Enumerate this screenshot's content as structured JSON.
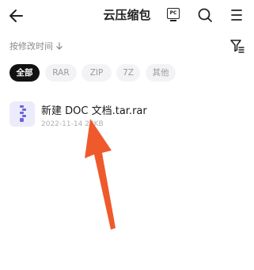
{
  "header": {
    "title": "云压缩包",
    "pc_icon_text": "PC"
  },
  "sort": {
    "label": "按修改时间",
    "direction_icon": "arrow-down-icon"
  },
  "filters": {
    "chips": [
      "全部",
      "RAR",
      "ZIP",
      "7Z",
      "其他"
    ],
    "selected": "全部"
  },
  "files": [
    {
      "name": "新建 DOC 文档.tar.rar",
      "date": "2022-11-14",
      "size": "28KB"
    }
  ],
  "colors": {
    "accent_arrow": "#ef5a2c",
    "file_icon_bg": "#ecebfb",
    "file_icon_fg": "#6b63d8",
    "chip_active_bg": "#121212",
    "chip_bg": "#f3f3f5"
  }
}
